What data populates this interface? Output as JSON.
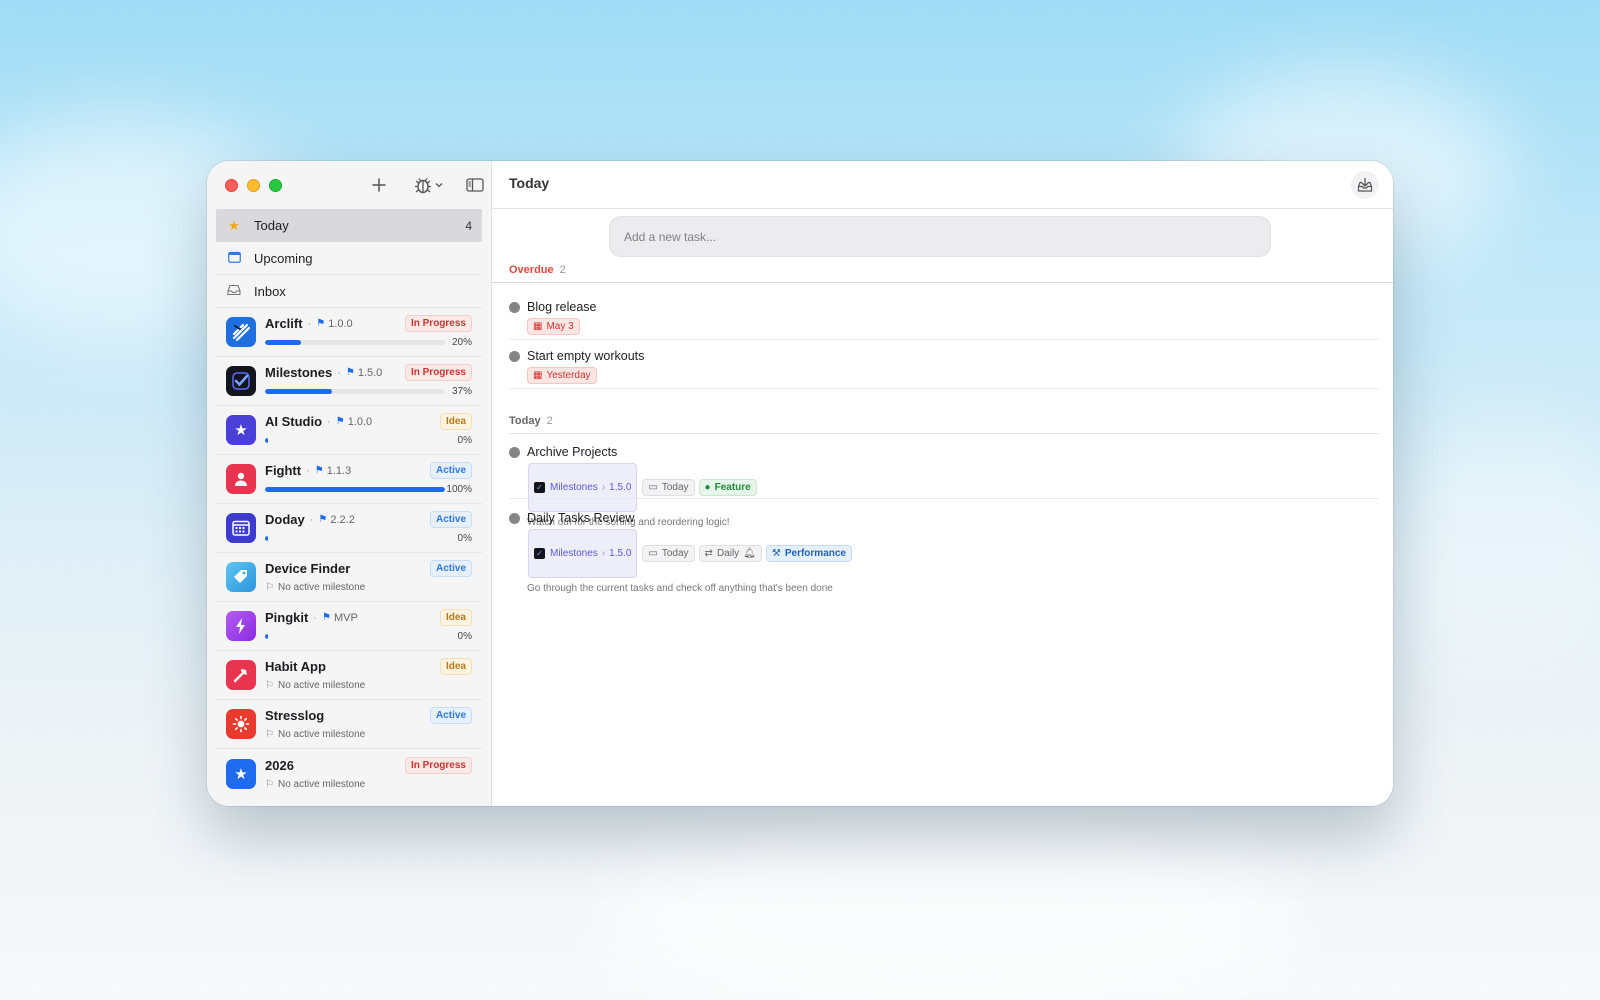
{
  "colors": {
    "accent": "#1e6bf0",
    "overdue": "#d0342c"
  },
  "sidebar": {
    "nav": [
      {
        "label": "Today",
        "count": "4",
        "icon": "star-icon"
      },
      {
        "label": "Upcoming",
        "count": "",
        "icon": "calendar-icon"
      },
      {
        "label": "Inbox",
        "count": "",
        "icon": "inbox-icon"
      }
    ],
    "projects": [
      {
        "name": "Arclift",
        "milestone": "1.0.0",
        "status": "In Progress",
        "progress": "20%",
        "progress_value": 0.2,
        "icon_color": "#1f6fe0"
      },
      {
        "name": "Milestones",
        "milestone": "1.5.0",
        "status": "In Progress",
        "progress": "37%",
        "progress_value": 0.37,
        "icon_color": "#14141c"
      },
      {
        "name": "AI Studio",
        "milestone": "1.0.0",
        "status": "Idea",
        "progress": "0%",
        "progress_value": 0.0,
        "icon_color": "#4a3fd6"
      },
      {
        "name": "Fightt",
        "milestone": "1.1.3",
        "status": "Active",
        "progress": "100%",
        "progress_value": 1.0,
        "icon_color": "#e8344e"
      },
      {
        "name": "Doday",
        "milestone": "2.2.2",
        "status": "Active",
        "progress": "0%",
        "progress_value": 0.0,
        "icon_color": "#3d3ad0"
      },
      {
        "name": "Device Finder",
        "milestone_text": "No active milestone",
        "status": "Active",
        "icon_color": "#3aaae8"
      },
      {
        "name": "Pingkit",
        "milestone": "MVP",
        "status": "Idea",
        "progress": "0%",
        "progress_value": 0.0,
        "icon_color": "#9b3be8"
      },
      {
        "name": "Habit App",
        "milestone_text": "No active milestone",
        "status": "Idea",
        "icon_color": "#e8344e"
      },
      {
        "name": "Stresslog",
        "milestone_text": "No active milestone",
        "status": "Active",
        "icon_color": "#ea3a2e"
      },
      {
        "name": "2026",
        "milestone_text": "No active milestone",
        "status": "In Progress",
        "icon_color": "#1e6bf0"
      }
    ]
  },
  "main": {
    "title": "Today",
    "add_task_placeholder": "Add a new task...",
    "sections": [
      {
        "title": "Overdue",
        "count": "2",
        "tasks": [
          {
            "title": "Blog release",
            "date": "May 3"
          },
          {
            "title": "Start empty workouts",
            "date": "Yesterday"
          }
        ]
      },
      {
        "title": "Today",
        "count": "2",
        "tasks": [
          {
            "title": "Archive Projects",
            "project": "Milestones",
            "milestone": "1.5.0",
            "date": "Today",
            "tag": "Feature",
            "note": "Watch out for the sorting and reordering logic!"
          },
          {
            "title": "Daily Tasks Review",
            "project": "Milestones",
            "milestone": "1.5.0",
            "date": "Today",
            "repeat": "Daily",
            "tag": "Performance",
            "note": "Go through the current tasks and check off anything that's been done"
          }
        ]
      }
    ]
  }
}
